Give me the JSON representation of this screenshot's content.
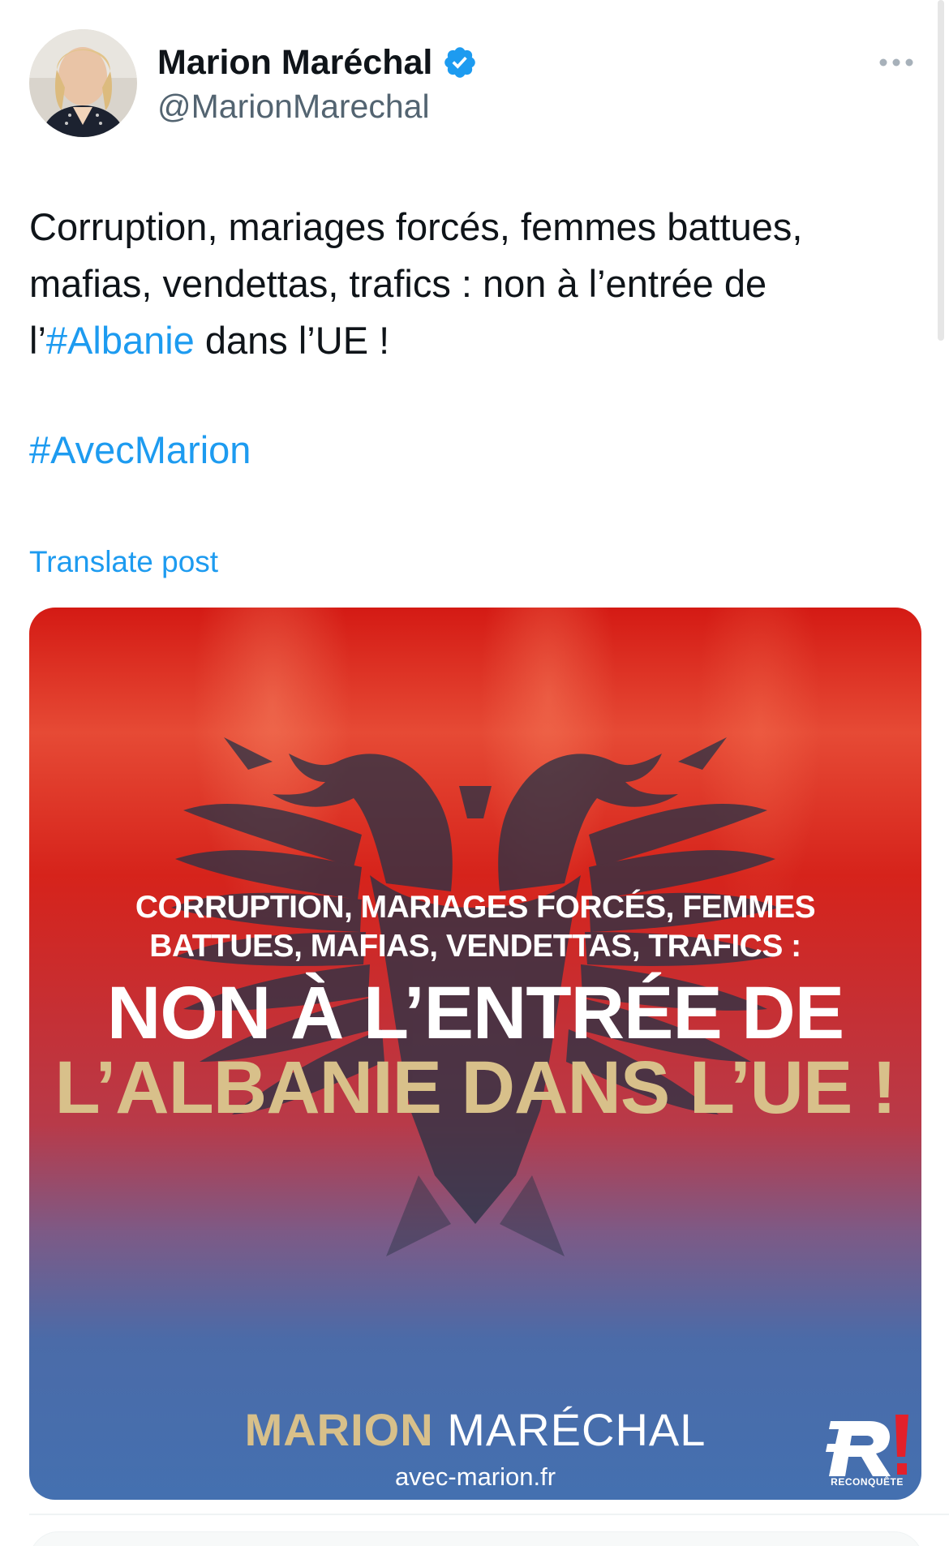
{
  "author": {
    "display_name": "Marion Maréchal",
    "handle": "@MarionMarechal",
    "verified": true,
    "verified_color": "#1d9bf0"
  },
  "tweet": {
    "line1": "Corruption, mariages forcés, femmes battues,",
    "line2": "mafias, vendettas, trafics : non à l’entrée de",
    "line3_prefix": "l’",
    "line3_hashtag": "#Albanie",
    "line3_suffix": " dans l’UE !",
    "hashtag_line": "#AvecMarion",
    "link_color": "#1d9bf0"
  },
  "translate_label": "Translate post",
  "media": {
    "subline1": "CORRUPTION, MARIAGES FORCÉS, FEMMES",
    "subline2": "BATTUES, MAFIAS, VENDETTAS, TRAFICS :",
    "main_line1": "NON À L’ENTRÉE DE",
    "main_line2": "L’ALBANIE DANS L’UE !",
    "signature_first": "MARION",
    "signature_last": "MARÉCHAL",
    "site": "avec-marion.fr",
    "logo_label": "RECONQUÊTE",
    "gold_color": "#d8c08a",
    "flag_red": "#d41a14",
    "blue": "#4470b0"
  },
  "icons": {
    "verified": "verified-badge-icon",
    "more": "more-options-icon"
  }
}
